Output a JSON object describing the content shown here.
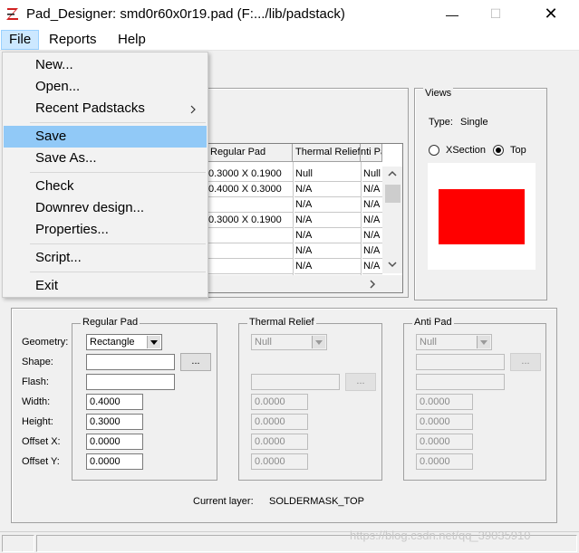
{
  "window": {
    "title": "Pad_Designer: smd0r60x0r19.pad (F:.../lib/padstack)",
    "controls": {
      "minimize": "—",
      "maximize": "☐",
      "close": "✕"
    }
  },
  "menubar": [
    "File",
    "Reports",
    "Help"
  ],
  "file_menu": {
    "items": [
      "New...",
      "Open...",
      "Recent Padstacks",
      "Save",
      "Save As...",
      "Check",
      "Downrev design...",
      "Properties...",
      "Script...",
      "Exit"
    ],
    "highlighted": "Save"
  },
  "layers_table": {
    "headers": [
      "Regular Pad",
      "Thermal Relief",
      "Anti Pad"
    ],
    "header_visible_text": [
      "Regular Pad",
      "Thermal Relief",
      "nti Pa"
    ],
    "rows": [
      [
        "0.3000 X 0.1900",
        "Null",
        "Null"
      ],
      [
        "0.4000 X 0.3000",
        "N/A",
        "N/A"
      ],
      [
        "",
        "N/A",
        "N/A"
      ],
      [
        "0.3000 X 0.1900",
        "N/A",
        "N/A"
      ],
      [
        "",
        "N/A",
        "N/A"
      ],
      [
        "",
        "N/A",
        "N/A"
      ],
      [
        "",
        "N/A",
        "N/A"
      ]
    ]
  },
  "views": {
    "title": "Views",
    "type_label": "Type:",
    "type_value": "Single",
    "options": [
      "XSection",
      "Top"
    ],
    "selected": "Top",
    "pad_color": "#ff0000"
  },
  "regular_pad": {
    "title": "Regular Pad",
    "labels": [
      "Geometry:",
      "Shape:",
      "Flash:",
      "Width:",
      "Height:",
      "Offset X:",
      "Offset Y:"
    ],
    "geometry": "Rectangle",
    "shape": "",
    "flash": "",
    "width": "0.4000",
    "height": "0.3000",
    "offset_x": "0.0000",
    "offset_y": "0.0000",
    "browse": "..."
  },
  "thermal_relief": {
    "title": "Thermal Relief",
    "geometry": "Null",
    "width": "0.0000",
    "height": "0.0000",
    "offset_x": "0.0000",
    "offset_y": "0.0000",
    "browse": "..."
  },
  "anti_pad": {
    "title": "Anti Pad",
    "geometry": "Null",
    "width": "0.0000",
    "height": "0.0000",
    "offset_x": "0.0000",
    "offset_y": "0.0000",
    "browse": "..."
  },
  "current_layer": {
    "label": "Current layer:",
    "value": "SOLDERMASK_TOP"
  },
  "watermark": "https://blog.csdn.net/qq_39035910",
  "colors": {
    "menu_highlight": "#91c9f7",
    "file_menu_active": "#cce8ff"
  }
}
